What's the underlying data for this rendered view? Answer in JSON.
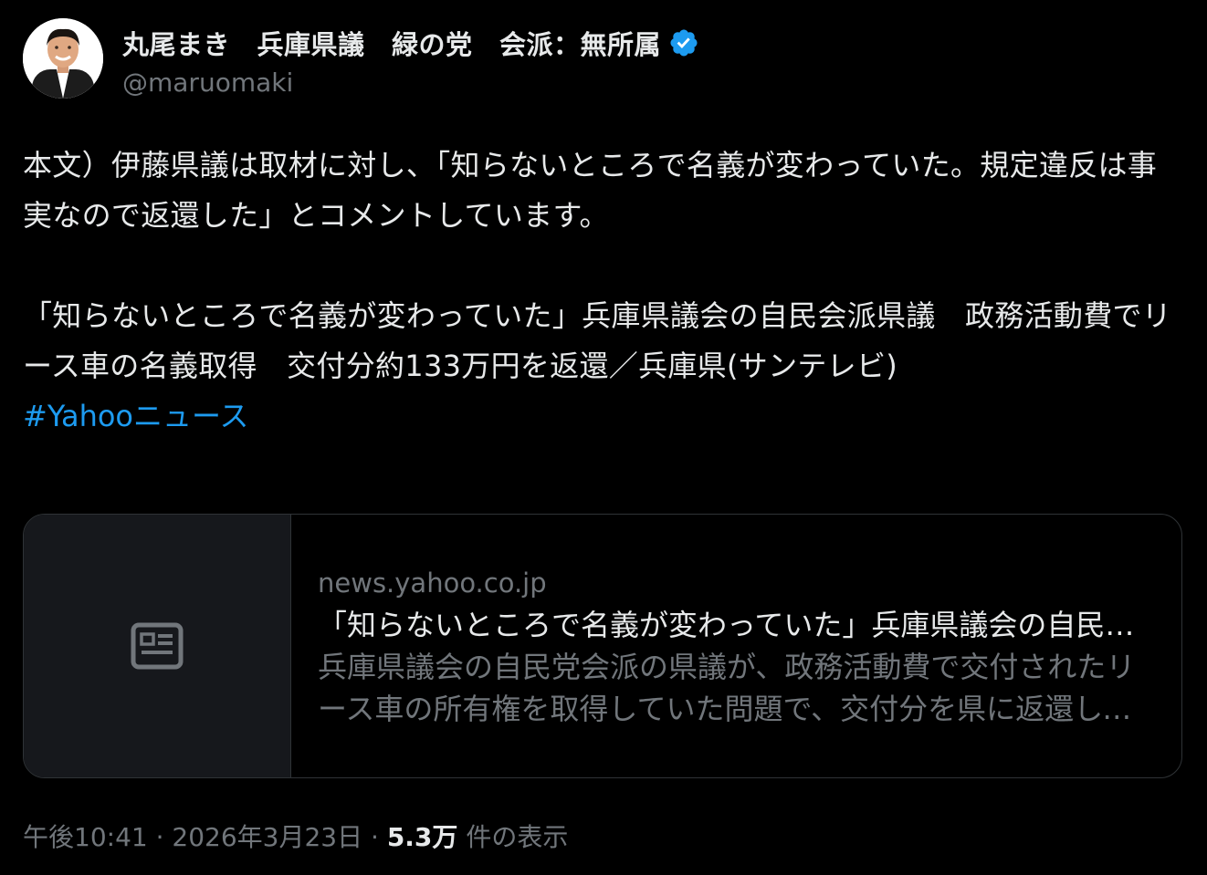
{
  "author": {
    "display_name": "丸尾まき　兵庫県議　緑の党　会派：無所属",
    "handle": "@maruomaki",
    "avatar_icon": "avatar-photo-icon",
    "verified_icon": "verified-badge-icon"
  },
  "post": {
    "text": "本文）伊藤県議は取材に対し、「知らないところで名義が変わっていた。規定違反は事実なので返還した」とコメントしています。\n\n「知らないところで名義が変わっていた」兵庫県議会の自民会派県議　政務活動費でリース車の名義取得　交付分約133万円を返還／兵庫県(サンテレビ)",
    "hashtag": "#Yahooニュース"
  },
  "link_card": {
    "thumb_icon": "news-article-icon",
    "domain": "news.yahoo.co.jp",
    "title": "「知らないところで名義が変わっていた」兵庫県議会の自民会派県議　政務活動費でリース車の名義取得　交付分約133万円を返還／兵庫県(サンテレビ)",
    "description": "兵庫県議会の自民党会派の県議が、政務活動費で交付されたリース車の所有権を取得していた問題で、交付分を県に返還していたことがわかりました。"
  },
  "meta": {
    "time": "午後10:41",
    "separator": " · ",
    "date": "2026年3月23日",
    "views_count": "5.3万",
    "views_label": " 件の表示"
  },
  "colors": {
    "background": "#000000",
    "text": "#e7e9ea",
    "secondary": "#71767b",
    "link": "#1d9bf0",
    "verified": "#1d9bf0",
    "border": "#2f3336"
  }
}
